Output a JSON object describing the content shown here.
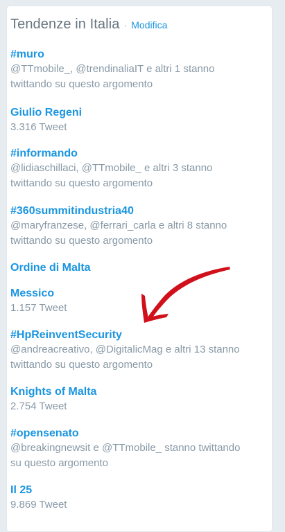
{
  "panel": {
    "title": "Tendenze in Italia",
    "separator": "·",
    "edit_label": "Modifica"
  },
  "trends": [
    {
      "name": "#muro",
      "desc": "@TTmobile_, @trendinaliaIT e altri 1 stanno twittando su questo argomento"
    },
    {
      "name": "Giulio Regeni",
      "desc": "3.316 Tweet"
    },
    {
      "name": "#informando",
      "desc": "@lidiaschillaci, @TTmobile_ e altri 3 stanno twittando su questo argomento"
    },
    {
      "name": "#360summitindustria40",
      "desc": "@maryfranzese, @ferrari_carla e altri 8 stanno twittando su questo argomento"
    },
    {
      "name": "Ordine di Malta",
      "desc": ""
    },
    {
      "name": "Messico",
      "desc": "1.157 Tweet"
    },
    {
      "name": "#HpReinventSecurity",
      "desc": "@andreacreativo, @DigitalicMag e altri 13 stanno twittando su questo argomento"
    },
    {
      "name": "Knights of Malta",
      "desc": "2.754 Tweet"
    },
    {
      "name": "#opensenato",
      "desc": "@breakingnewsit e @TTmobile_ stanno twittando su questo argomento"
    },
    {
      "name": "Il 25",
      "desc": "9.869 Tweet"
    }
  ],
  "colors": {
    "link": "#1b95e0",
    "secondary_text": "#8899a6",
    "title_text": "#66757f",
    "annotation_arrow": "#d0111b"
  },
  "annotation": {
    "icon": "red-arrow-icon",
    "points_to": "#HpReinventSecurity"
  }
}
